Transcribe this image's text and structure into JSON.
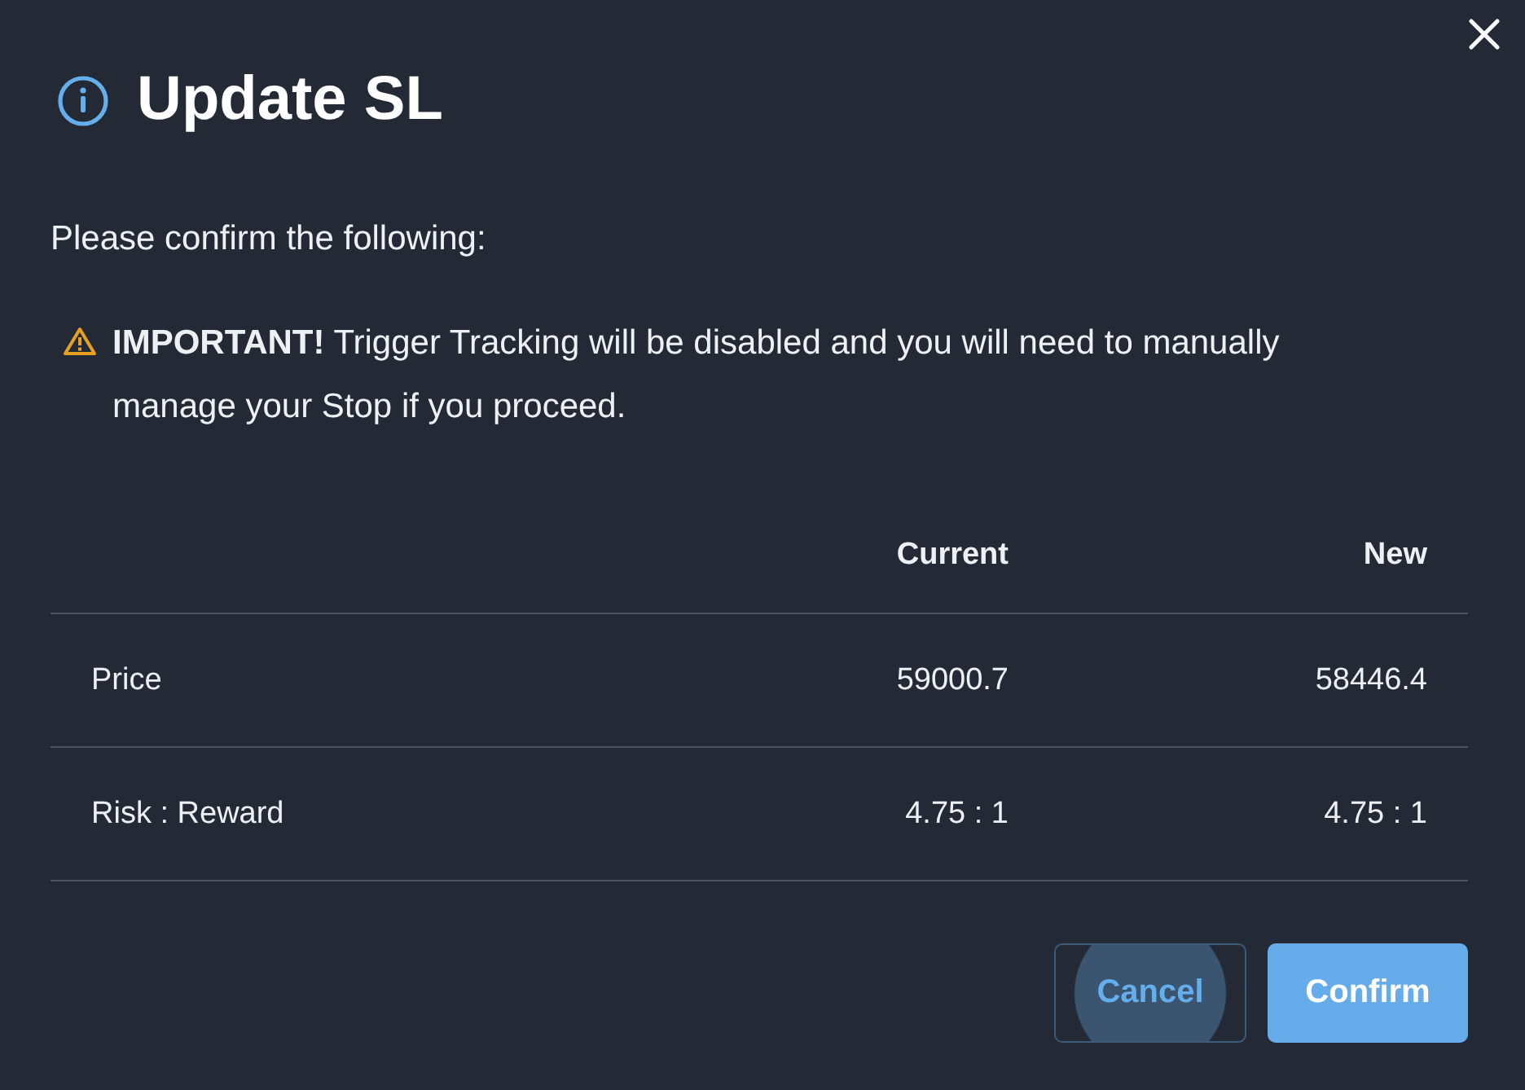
{
  "dialog": {
    "title": "Update SL",
    "intro": "Please confirm the following:",
    "warning": "**IMPORTANT!** Trigger Tracking will be disabled and you will need to manually manage your Stop if you proceed."
  },
  "table": {
    "columns": [
      "Current",
      "New"
    ],
    "rows": [
      {
        "label": "Price",
        "current": "59000.7",
        "new": "58446.4"
      },
      {
        "label": "Risk : Reward",
        "current": "4.75 : 1",
        "new": "4.75 : 1"
      }
    ]
  },
  "buttons": [
    {
      "label": "Cancel",
      "kind": "secondary",
      "focused": true
    },
    {
      "label": "Confirm",
      "kind": "primary",
      "focused": false
    }
  ]
}
